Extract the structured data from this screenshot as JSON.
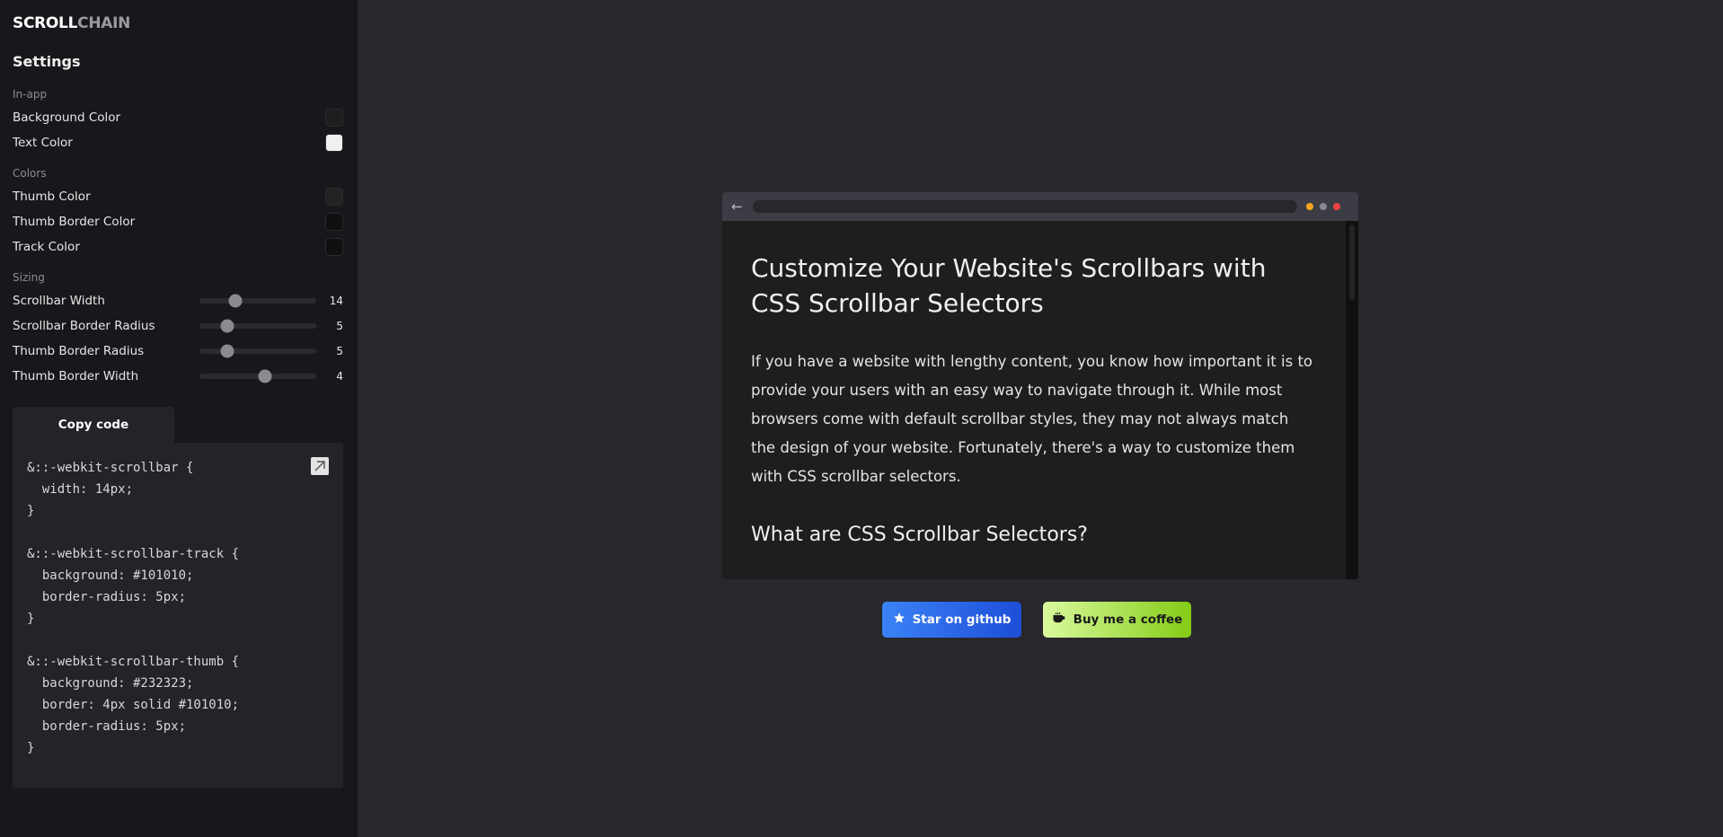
{
  "logo": {
    "part1": "SCROLL",
    "part2": "CHAIN"
  },
  "settings": {
    "title": "Settings",
    "sections": {
      "inapp": "In-app",
      "colors": "Colors",
      "sizing": "Sizing"
    },
    "inapp": [
      {
        "label": "Background Color",
        "color": "#1e1e1e"
      },
      {
        "label": "Text Color",
        "color": "#f0f0f0"
      }
    ],
    "colors": [
      {
        "label": "Thumb Color",
        "color": "#232323"
      },
      {
        "label": "Thumb Border Color",
        "color": "#101010"
      },
      {
        "label": "Track Color",
        "color": "#101010"
      }
    ],
    "sizing": [
      {
        "label": "Scrollbar Width",
        "value": "14",
        "fraction": 0.31
      },
      {
        "label": "Scrollbar Border Radius",
        "value": "5",
        "fraction": 0.24
      },
      {
        "label": "Thumb Border Radius",
        "value": "5",
        "fraction": 0.24
      },
      {
        "label": "Thumb Border Width",
        "value": "4",
        "fraction": 0.56
      }
    ]
  },
  "code": {
    "tab_label": "Copy code",
    "text": "&::-webkit-scrollbar {\n  width: 14px;\n}\n\n&::-webkit-scrollbar-track {\n  background: #101010;\n  border-radius: 5px;\n}\n\n&::-webkit-scrollbar-thumb {\n  background: #232323;\n  border: 4px solid #101010;\n  border-radius: 5px;\n}"
  },
  "preview": {
    "back_icon": "arrow-left-icon",
    "dot_colors": [
      "#f5a623",
      "#8a8a90",
      "#ef4444"
    ],
    "heading": "Customize Your Website's Scrollbars with CSS Scrollbar Selectors",
    "paragraph": "If you have a website with lengthy content, you know how important it is to provide your users with an easy way to navigate through it. While most browsers come with default scrollbar styles, they may not always match the design of your website. Fortunately, there's a way to customize them with CSS scrollbar selectors.",
    "subheading": "What are CSS Scrollbar Selectors?"
  },
  "buttons": {
    "github": {
      "label": "Star on github",
      "icon": "star-icon"
    },
    "coffee": {
      "label": "Buy me a coffee",
      "icon": "coffee-icon"
    }
  }
}
